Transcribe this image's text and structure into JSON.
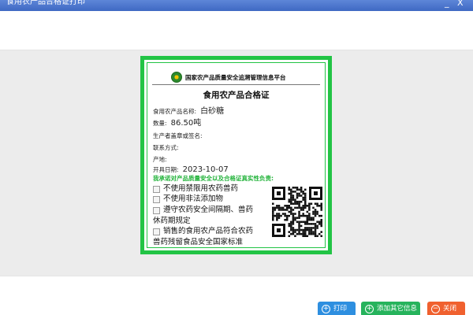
{
  "window": {
    "title": "食用农产品合格证打印",
    "minimize_label": "_",
    "close_label": "X"
  },
  "certificate": {
    "platform_name": "国家农产品质量安全追溯管理信息平台",
    "title": "食用农产品合格证",
    "fields": {
      "product_name_label": "食用农产品名称:",
      "product_name_value": "白砂糖",
      "quantity_label": "数量:",
      "quantity_value": "86.50吨",
      "producer_label": "生产者盖章或签名:",
      "producer_value": "",
      "contact_label": "联系方式:",
      "contact_value": "",
      "origin_label": "产地:",
      "origin_value": "",
      "issue_date_label": "开具日期:",
      "issue_date_value": "2023-10-07"
    },
    "pledge_title": "我承诺对产品质量安全以及合格证真实性负责:",
    "pledge_items": [
      {
        "line1": "不使用禁限用农药兽药",
        "line2": ""
      },
      {
        "line1": "不使用非法添加物",
        "line2": ""
      },
      {
        "line1": "遵守农药安全间隔期、兽药",
        "line2": "休药期规定"
      },
      {
        "line1": "销售的食用农产品符合农药",
        "line2": "兽药残留食品安全国家标准"
      }
    ]
  },
  "buttons": {
    "print": "打印",
    "add_other": "添加其它信息",
    "close": "关闭"
  },
  "icons": {
    "print": "plus-circle-icon",
    "add_other": "plus-circle-icon",
    "close": "minus-circle-icon"
  },
  "colors": {
    "title_bar": "#4a74cc",
    "certificate_border": "#22c445",
    "pledge_text": "#22b33a",
    "print_button": "#2e8fe0",
    "add_button": "#26b35c",
    "close_button": "#f0612f"
  }
}
